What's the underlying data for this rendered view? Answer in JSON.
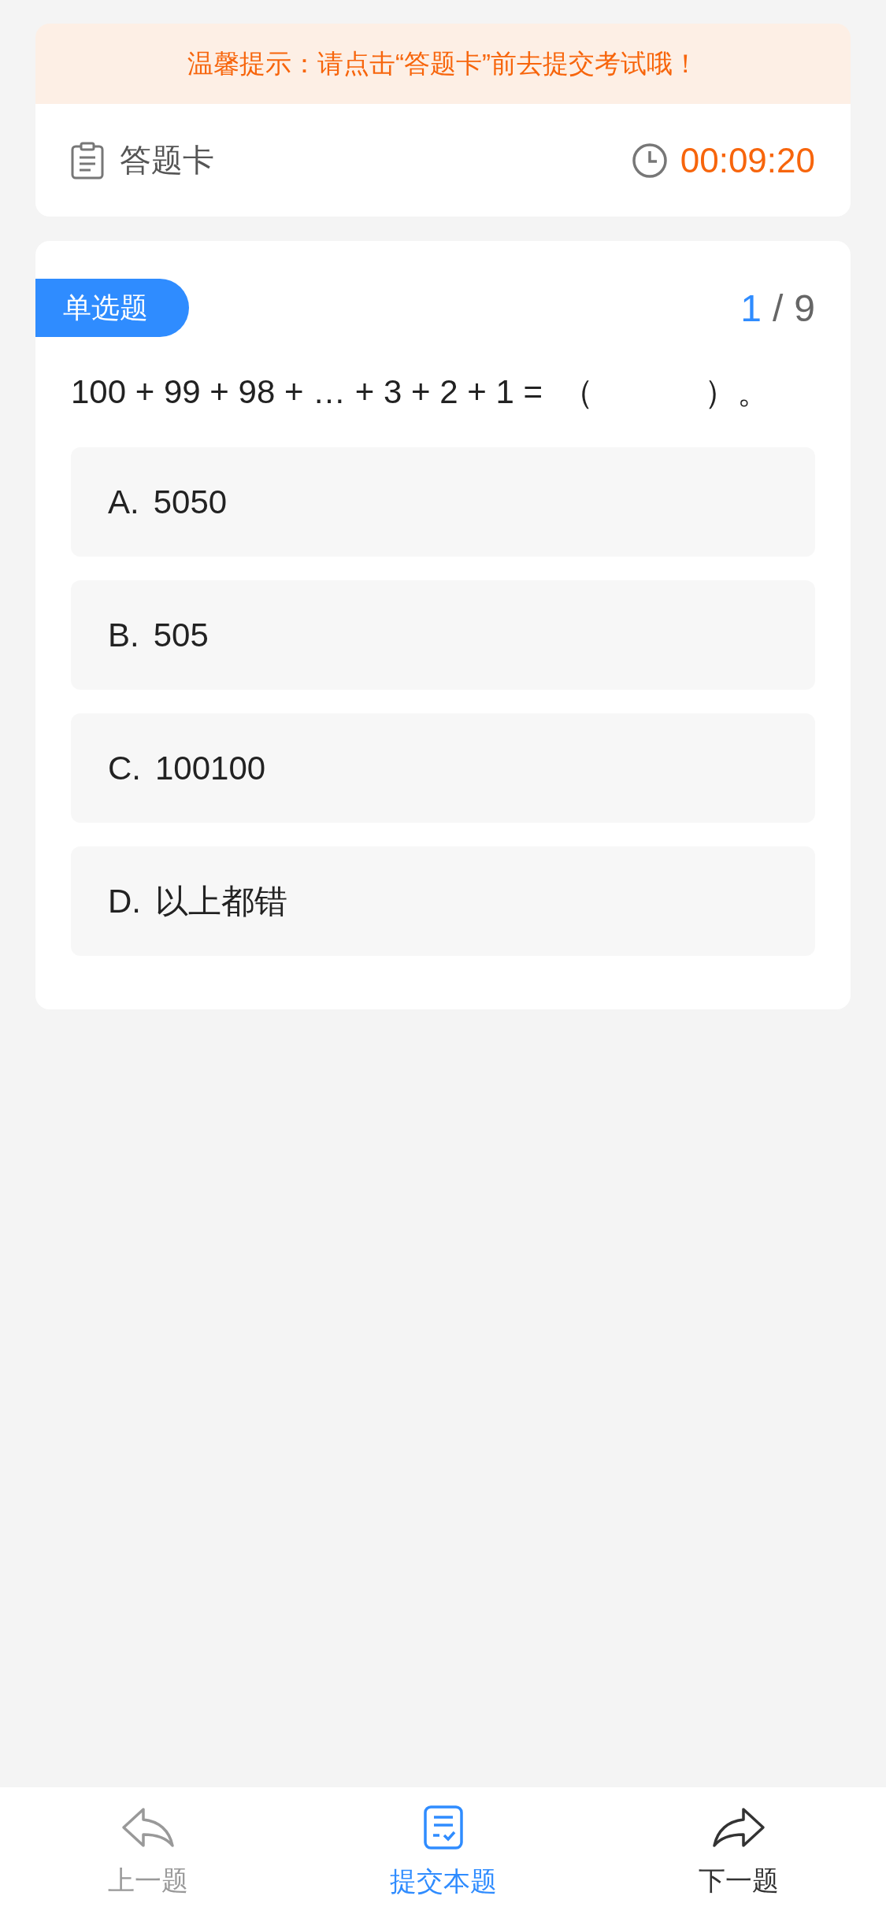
{
  "notice": "温馨提示：请点击“答题卡”前去提交考试哦！",
  "header": {
    "title": "答题卡",
    "timer": "00:09:20"
  },
  "question": {
    "type_tag": "单选题",
    "current": "1",
    "separator": "/",
    "total": "9",
    "text": "100 + 99 + 98 + … + 3 + 2 + 1 =  （            ）。",
    "options": [
      {
        "letter": "A.",
        "text": "5050",
        "selected": false
      },
      {
        "letter": "B.",
        "text": "505",
        "selected": false
      },
      {
        "letter": "C.",
        "text": "100100",
        "selected": false
      },
      {
        "letter": "D.",
        "text": "以上都错",
        "selected": false
      }
    ]
  },
  "bottom_nav": [
    {
      "label": "上一题",
      "kind": "previous",
      "disabled": true
    },
    {
      "label": "提交本题",
      "kind": "submit",
      "disabled": false
    },
    {
      "label": "下一题",
      "kind": "next",
      "disabled": false
    }
  ]
}
